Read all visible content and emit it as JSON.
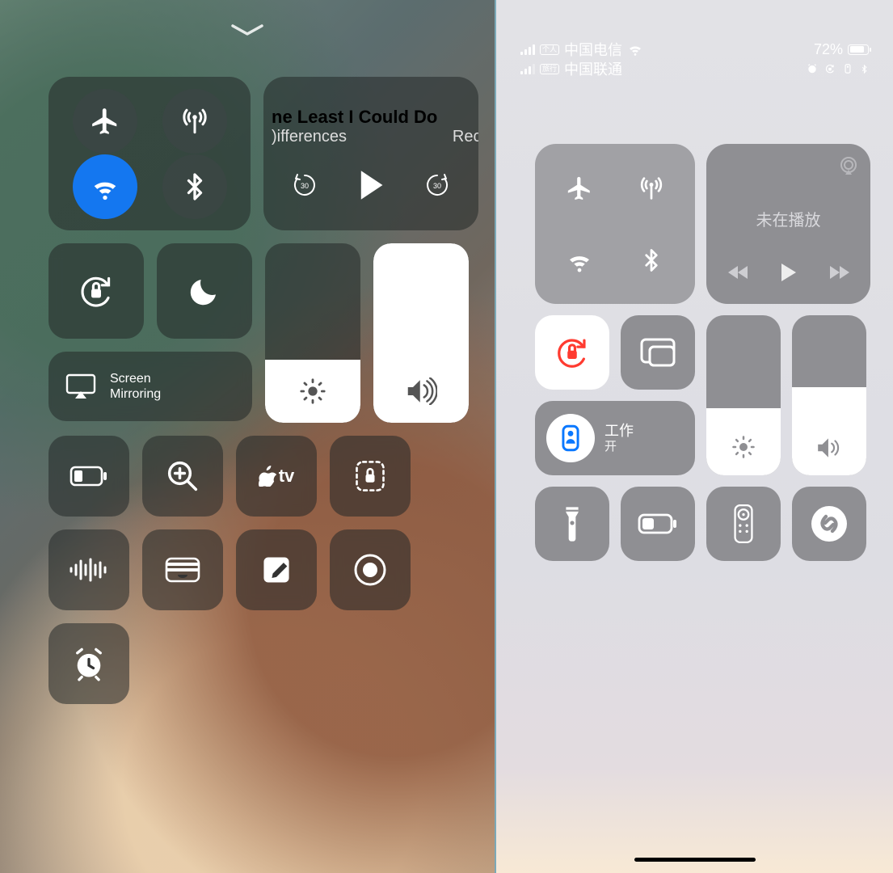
{
  "left": {
    "music": {
      "title_partial": "ne Least I Could Do",
      "subtitle_left": ")ifferences",
      "subtitle_right": "Reco"
    },
    "screen_mirroring_line1": "Screen",
    "screen_mirroring_line2": "Mirroring",
    "brightness_pct": 35,
    "volume_pct": 100,
    "apple_tv_label": "tv"
  },
  "right": {
    "status": {
      "sim1_tag": "个人",
      "sim1_carrier": "中国电信",
      "sim2_tag": "旅行",
      "sim2_carrier": "中国联通",
      "battery_text": "72%",
      "battery_pct": 72
    },
    "music_not_playing": "未在播放",
    "focus": {
      "title": "工作",
      "state": "开"
    },
    "brightness_pct": 42,
    "volume_pct": 55
  }
}
